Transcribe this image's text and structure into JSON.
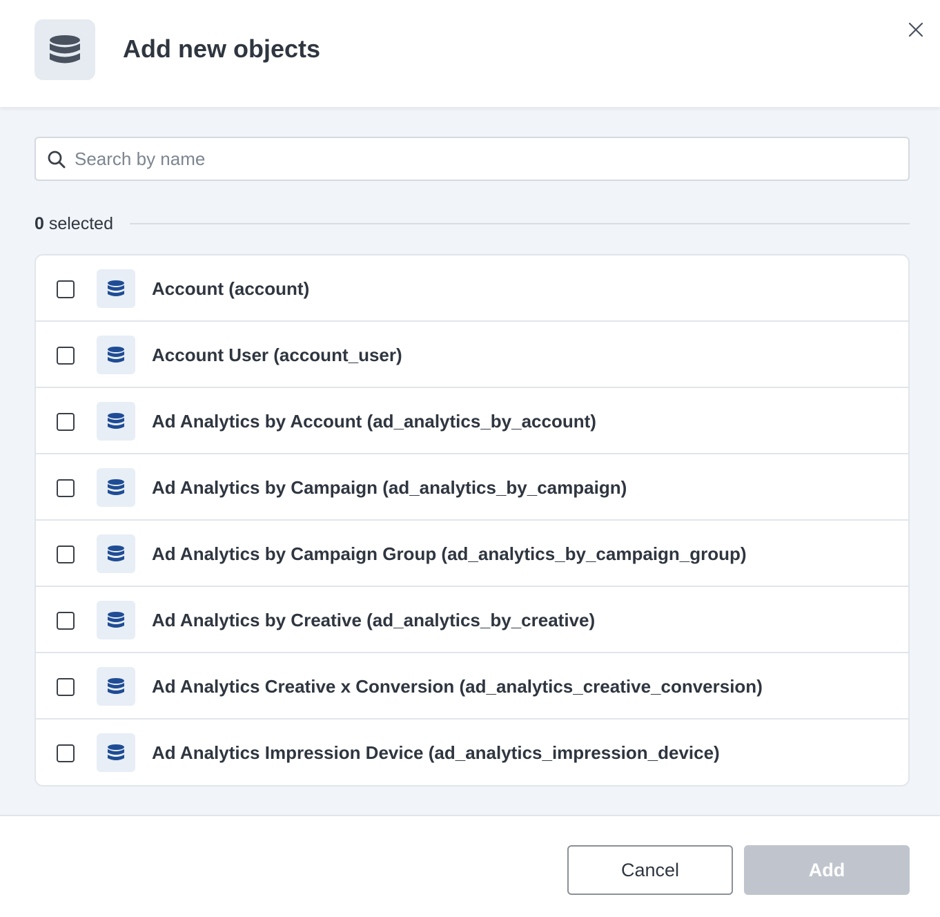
{
  "header": {
    "title": "Add new objects",
    "icon": "database-icon"
  },
  "search": {
    "placeholder": "Search by name",
    "value": ""
  },
  "selection": {
    "count": "0",
    "suffix": " selected"
  },
  "objects": [
    {
      "label": "Account (account)",
      "checked": false
    },
    {
      "label": "Account User (account_user)",
      "checked": false
    },
    {
      "label": "Ad Analytics by Account (ad_analytics_by_account)",
      "checked": false
    },
    {
      "label": "Ad Analytics by Campaign (ad_analytics_by_campaign)",
      "checked": false
    },
    {
      "label": "Ad Analytics by Campaign Group (ad_analytics_by_campaign_group)",
      "checked": false
    },
    {
      "label": "Ad Analytics by Creative (ad_analytics_by_creative)",
      "checked": false
    },
    {
      "label": "Ad Analytics Creative x Conversion (ad_analytics_creative_conversion)",
      "checked": false
    },
    {
      "label": "Ad Analytics Impression Device (ad_analytics_impression_device)",
      "checked": false
    }
  ],
  "footer": {
    "cancel_label": "Cancel",
    "add_label": "Add",
    "add_disabled": true
  },
  "colors": {
    "header_icon": "#4a5260",
    "item_icon": "#1f4c94",
    "add_button_disabled": "#c0c5cd",
    "body_background": "#f1f4f8"
  }
}
